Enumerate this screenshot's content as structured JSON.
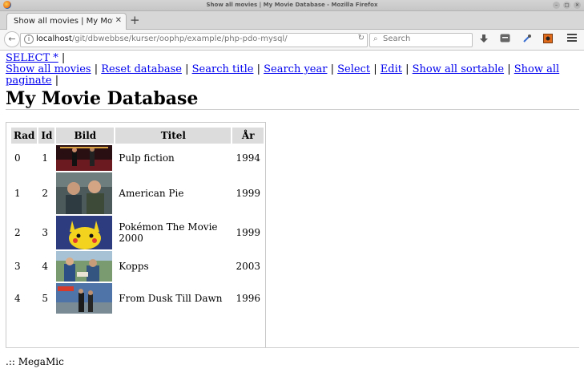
{
  "window": {
    "title": "Show all movies | My Movie Database - Mozilla Firefox",
    "minimize": "–",
    "maximize": "□",
    "close": "✕"
  },
  "tab": {
    "label": "Show all movies | My Movie Database",
    "close": "✕",
    "new_tab": "+"
  },
  "navbar": {
    "back": "←",
    "url_host": "localhost",
    "url_path": "/git/dbwebbse/kurser/oophp/example/php-pdo-mysql/",
    "reload": "↻",
    "search_placeholder": "Search",
    "search_icon": "⌕"
  },
  "toolbar_icons": [
    "download-icon",
    "pocket-icon",
    "eyedropper-icon",
    "addon-icon",
    "menu-icon"
  ],
  "nav": {
    "select_star": "SELECT *",
    "links": [
      "Show all movies",
      "Reset database",
      "Search title",
      "Search year",
      "Select",
      "Edit",
      "Show all sortable",
      "Show all paginate"
    ],
    "separator": "|"
  },
  "page_title": "My Movie Database",
  "table": {
    "headers": [
      "Rad",
      "Id",
      "Bild",
      "Titel",
      "År"
    ],
    "rows": [
      {
        "rad": "0",
        "id": "1",
        "titel": "Pulp fiction",
        "ar": "1994",
        "thumb": "pulp",
        "h": 32
      },
      {
        "rad": "1",
        "id": "2",
        "titel": "American Pie",
        "ar": "1999",
        "thumb": "pie",
        "h": 52
      },
      {
        "rad": "2",
        "id": "3",
        "titel": "Pokémon The Movie 2000",
        "ar": "1999",
        "thumb": "pokemon",
        "h": 42
      },
      {
        "rad": "3",
        "id": "4",
        "titel": "Kopps",
        "ar": "2003",
        "thumb": "kopps",
        "h": 38
      },
      {
        "rad": "4",
        "id": "5",
        "titel": "From Dusk Till Dawn",
        "ar": "1996",
        "thumb": "dusk",
        "h": 38
      }
    ]
  },
  "footer": ".:: MegaMic"
}
